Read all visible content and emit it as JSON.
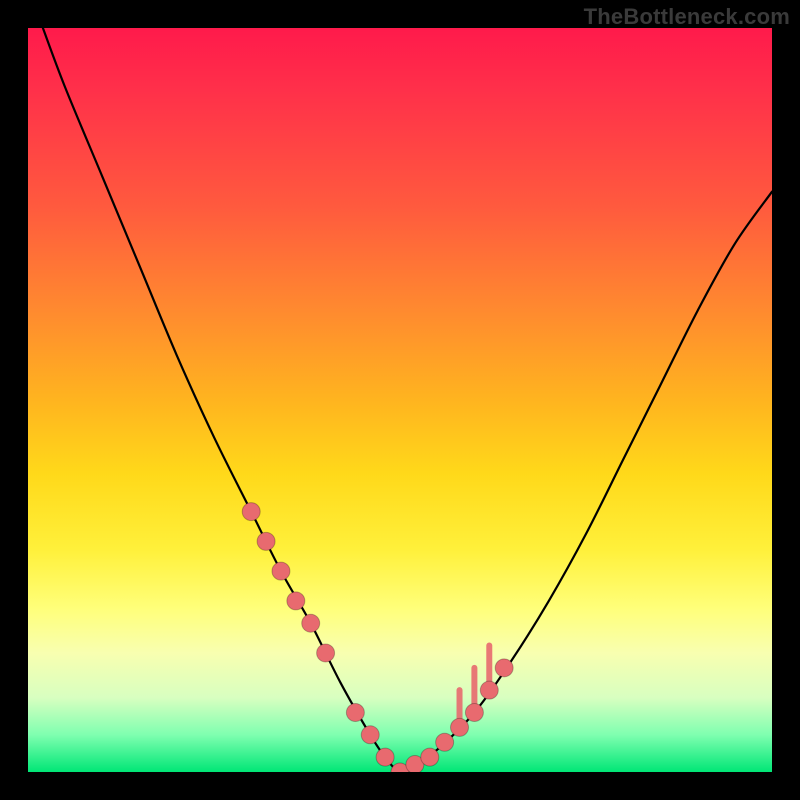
{
  "watermark": "TheBottleneck.com",
  "colors": {
    "frame": "#000000",
    "curve": "#000000",
    "marker": "#e86a6f",
    "gradient_stops": [
      "#ff1a4b",
      "#ff2f4a",
      "#ff5a3e",
      "#ff8a2f",
      "#ffb41f",
      "#ffd91a",
      "#fff03a",
      "#ffff7a",
      "#f8ffb0",
      "#d8ffc0",
      "#7fffb0",
      "#00e676"
    ]
  },
  "chart_data": {
    "type": "line",
    "title": "",
    "xlabel": "",
    "ylabel": "",
    "x_range": [
      0,
      100
    ],
    "y_range": [
      0,
      100
    ],
    "grid": false,
    "legend": false,
    "series": [
      {
        "name": "bottleneck-curve",
        "x": [
          2,
          5,
          10,
          15,
          20,
          25,
          30,
          34,
          38,
          42,
          46,
          48,
          50,
          52,
          55,
          60,
          65,
          70,
          75,
          80,
          85,
          90,
          95,
          100
        ],
        "y": [
          100,
          92,
          80,
          68,
          56,
          45,
          35,
          27,
          20,
          12,
          5,
          2,
          0,
          1,
          3,
          8,
          15,
          23,
          32,
          42,
          52,
          62,
          71,
          78
        ]
      }
    ],
    "markers": {
      "name": "highlighted-points",
      "x": [
        30,
        32,
        34,
        36,
        38,
        40,
        44,
        46,
        48,
        50,
        52,
        54,
        56,
        58,
        60,
        62,
        64
      ],
      "y": [
        35,
        31,
        27,
        23,
        20,
        16,
        8,
        5,
        2,
        0,
        1,
        2,
        4,
        6,
        8,
        11,
        14
      ]
    },
    "stems": {
      "name": "right-stems",
      "x": [
        58,
        60,
        62
      ],
      "y0": [
        6,
        8,
        11
      ],
      "y1": [
        11,
        14,
        17
      ]
    }
  }
}
